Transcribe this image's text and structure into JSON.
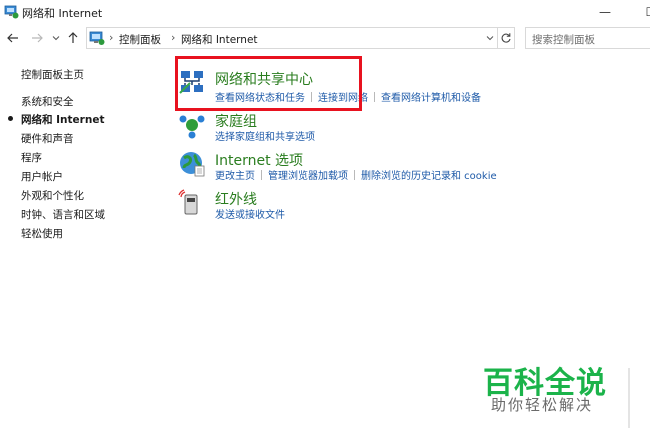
{
  "window": {
    "title": "网络和 Internet",
    "minimize_glyph": "—",
    "maximize_glyph": "☐"
  },
  "address_bar": {
    "crumbs": [
      "控制面板",
      "网络和 Internet"
    ],
    "separator": "›",
    "search_placeholder": "搜索控制面板"
  },
  "sidebar": {
    "items": [
      {
        "label": "控制面板主页",
        "current": false
      },
      {
        "label": "系统和安全",
        "current": false
      },
      {
        "label": "网络和 Internet",
        "current": true
      },
      {
        "label": "硬件和声音",
        "current": false
      },
      {
        "label": "程序",
        "current": false
      },
      {
        "label": "用户帐户",
        "current": false
      },
      {
        "label": "外观和个性化",
        "current": false
      },
      {
        "label": "时钟、语言和区域",
        "current": false
      },
      {
        "label": "轻松使用",
        "current": false
      }
    ]
  },
  "categories": [
    {
      "title": "网络和共享中心",
      "icon": "network-sharing-center-icon",
      "links": [
        "查看网络状态和任务",
        "连接到网络",
        "查看网络计算机和设备"
      ]
    },
    {
      "title": "家庭组",
      "icon": "homegroup-icon",
      "links": [
        "选择家庭组和共享选项"
      ]
    },
    {
      "title": "Internet 选项",
      "icon": "internet-options-icon",
      "links": [
        "更改主页",
        "管理浏览器加载项",
        "删除浏览的历史记录和 cookie"
      ]
    },
    {
      "title": "红外线",
      "icon": "infrared-icon",
      "links": [
        "发送或接收文件"
      ]
    }
  ],
  "watermark": {
    "main": "百科全说",
    "sub": "助你轻松解决"
  },
  "colors": {
    "category_title": "#2a7d1f",
    "link": "#1e5aa8",
    "highlight_border": "#e8121f",
    "watermark_main": "#1bb34a",
    "watermark_sub": "#6a6a6a"
  }
}
